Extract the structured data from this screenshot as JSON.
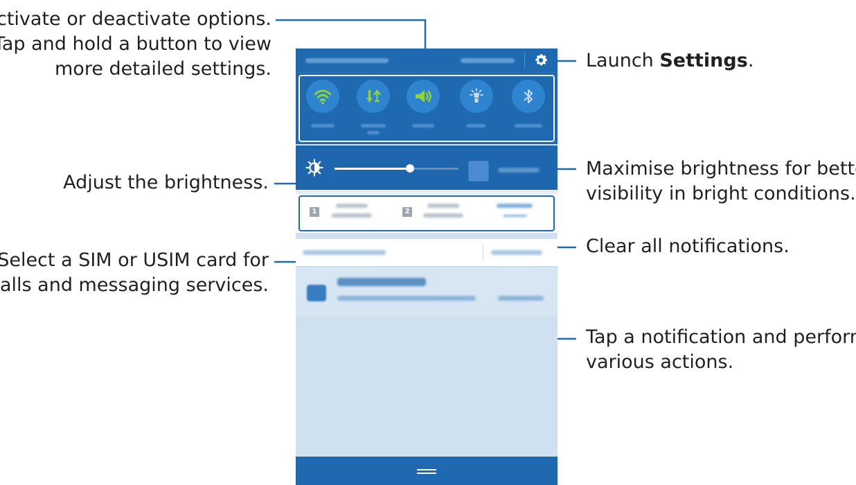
{
  "callouts": {
    "activate_line1": "Activate or deactivate options.",
    "activate_line2": "Tap and hold a button to view",
    "activate_line3": "more detailed settings.",
    "settings_prefix": "Launch ",
    "settings_bold": "Settings",
    "settings_suffix": ".",
    "brightness": "Adjust the brightness.",
    "max_line1": "Maximise brightness for better",
    "max_line2": "visibility in bright conditions.",
    "sim_line1": "Select a SIM or USIM card for",
    "sim_line2": "calls and messaging services.",
    "clear": "Clear all notifications.",
    "tap_line1": "Tap a notification and perform",
    "tap_line2": "various actions."
  },
  "phone": {
    "quick_settings": [
      {
        "icon": "wifi-icon"
      },
      {
        "icon": "mobile-data-icon"
      },
      {
        "icon": "sound-icon"
      },
      {
        "icon": "torch-icon"
      },
      {
        "icon": "bluetooth-icon"
      }
    ],
    "sim_badges": [
      "1",
      "2"
    ],
    "colors": {
      "panel_blue": "#1f69b1",
      "toggle_green": "#8ed43a",
      "leader_blue": "#1f69b1"
    }
  }
}
